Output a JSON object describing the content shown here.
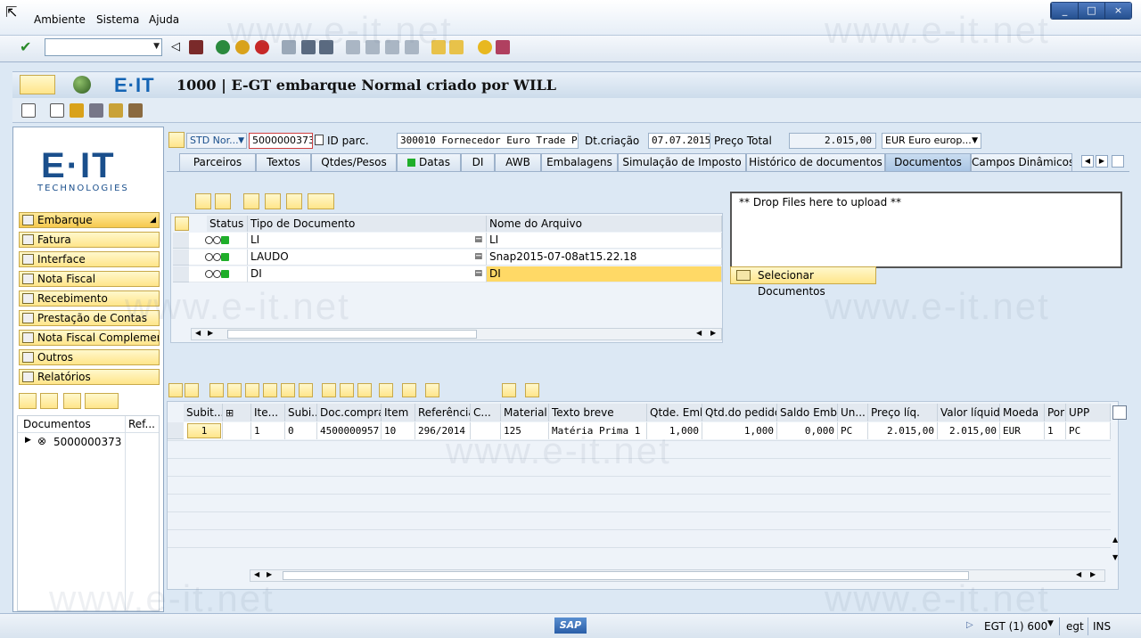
{
  "menu": [
    "Ambiente",
    "Sistema",
    "Ajuda"
  ],
  "window_controls": [
    "_",
    "□",
    "×"
  ],
  "title": "1000 | E-GT embarque Normal criado por WILL",
  "logo_text": "E·IT",
  "nav": {
    "logo_main": "E·IT",
    "logo_sub": "TECHNOLOGIES",
    "items": [
      "Embarque",
      "Fatura",
      "Interface",
      "Nota Fiscal",
      "Recebimento",
      "Prestação de Contas",
      "Nota Fiscal Complementar",
      "Outros",
      "Relatórios"
    ],
    "tree_headers": [
      "Documentos",
      "Ref..."
    ],
    "tree_node": "5000000373"
  },
  "header": {
    "type_value": "STD Nor...",
    "doc_number": "5000000373",
    "id_parc_label": "ID parc.",
    "id_parc_value": "300010 Fornecedor Euro Trade P",
    "dt_label": "Dt.criação",
    "dt_value": "07.07.2015",
    "preco_label": "Preço Total",
    "preco_value": "2.015,00",
    "currency_value": "EUR Euro europ..."
  },
  "tabs": [
    "Parceiros",
    "Textos",
    "Qtdes/Pesos",
    "Datas",
    "DI",
    "AWB",
    "Embalagens",
    "Simulação de Imposto",
    "Histórico de documentos",
    "Documentos",
    "Campos Dinâmicos"
  ],
  "documents": {
    "headers": [
      "Status",
      "Tipo de Documento",
      "Nome do Arquivo"
    ],
    "rows": [
      {
        "tipo": "LI",
        "nome": "LI"
      },
      {
        "tipo": "LAUDO",
        "nome": "Snap2015-07-08at15.22.18"
      },
      {
        "tipo": "DI",
        "nome": "DI"
      }
    ],
    "drop_text": "** Drop Files here to upload **",
    "select_button": "Selecionar Documentos"
  },
  "items": {
    "headers": [
      "Subit...",
      "Ite...",
      "Subi...",
      "Doc.compras",
      "Item",
      "Referência",
      "C...",
      "Material",
      "Texto breve",
      "Qtde. Emb",
      "Qtd.do pedido",
      "Saldo Embq",
      "Un...",
      "Preço líq.",
      "Valor líquido",
      "Moeda",
      "Por",
      "UPP"
    ],
    "row": [
      "1",
      "1",
      "0",
      "4500000957",
      "10",
      "296/2014",
      "",
      "125",
      "Matéria Prima 1",
      "1,000",
      "1,000",
      "0,000",
      "PC",
      "2.015,00",
      "2.015,00",
      "EUR",
      "1",
      "PC"
    ]
  },
  "status": {
    "system": "EGT (1) 600",
    "client": "egt",
    "mode": "INS",
    "brand": "SAP"
  },
  "watermark": "www.e-it.net",
  "colors": {
    "accent": "#1464b4",
    "nav_button": "#ffe58a",
    "selected_row": "#ffd966",
    "led_green": "#1fae2a"
  }
}
